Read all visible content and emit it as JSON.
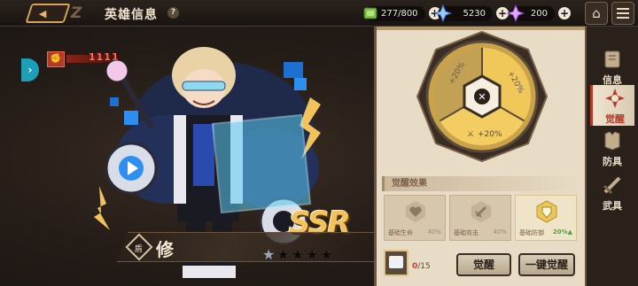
{
  "header": {
    "title": "英雄信息",
    "help_label": "?",
    "back_label": "◀",
    "logo_mark": "Z"
  },
  "resources": [
    {
      "name": "stamina",
      "icon": "green-gem-icon",
      "value": "277/800"
    },
    {
      "name": "blue-crystal",
      "icon": "blue-crystal-icon",
      "value": "5230"
    },
    {
      "name": "purple-crystal",
      "icon": "purple-crystal-icon",
      "value": "200"
    }
  ],
  "hero": {
    "power_value": "1111",
    "power_icon": "fist-icon",
    "name": "修",
    "rarity": "SSR",
    "class_glyph": "盾",
    "stars_total": 5,
    "stars_filled": 1
  },
  "awaken_wheel": {
    "segments": [
      {
        "label": "+20%",
        "icon": "shield-icon"
      },
      {
        "label": "+20%",
        "icon": "heart-icon"
      },
      {
        "label": "+20%",
        "icon": "sword-icon"
      }
    ]
  },
  "awaken_effects": {
    "section_title": "觉醒效果",
    "stats": [
      {
        "label": "基础生命",
        "value": "40%",
        "icon": "heart-icon",
        "active": false
      },
      {
        "label": "基础攻击",
        "value": "40%",
        "icon": "sword-icon",
        "active": false
      },
      {
        "label": "基础防御",
        "value": "20%▲",
        "icon": "shield-icon",
        "active": true
      }
    ]
  },
  "material": {
    "icon": "scroll-item-icon",
    "count_have": "0",
    "count_need": "/15"
  },
  "buttons": {
    "awaken": "觉醒",
    "one_click_awaken": "一键觉醒"
  },
  "tabs": [
    {
      "label": "信息",
      "icon": "book-icon",
      "active": false
    },
    {
      "label": "觉醒",
      "icon": "awaken-icon",
      "active": true
    },
    {
      "label": "防具",
      "icon": "armor-icon",
      "active": false
    },
    {
      "label": "武具",
      "icon": "weapon-icon",
      "active": false
    }
  ],
  "colors": {
    "accent_gold": "#f2c35c",
    "accent_red": "#b33a2a",
    "panel_bg": "#e8dcc6",
    "stat_active": "#4aa34a",
    "cyan": "#1d9fb8"
  }
}
